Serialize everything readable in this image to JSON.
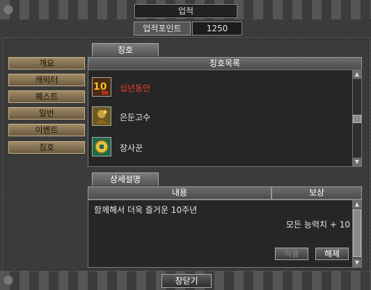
{
  "window": {
    "title": "업적"
  },
  "points": {
    "label": "업적포인트",
    "value": "1250"
  },
  "sidebar": {
    "items": [
      {
        "label": "개요"
      },
      {
        "label": "캐릭터"
      },
      {
        "label": "퀘스트"
      },
      {
        "label": "일반"
      },
      {
        "label": "이벤트"
      },
      {
        "label": "칭호"
      }
    ]
  },
  "title_tab": {
    "label": "칭호"
  },
  "title_list": {
    "header": "칭호목록",
    "items": [
      {
        "label": "십년동안",
        "icon": "tenth-anniversary-icon",
        "color": "#ff3b2f"
      },
      {
        "label": "은둔고수",
        "icon": "hermit-master-icon",
        "color": "#e8e8e8"
      },
      {
        "label": "장사꾼",
        "icon": "coin-icon",
        "color": "#e8e8e8"
      }
    ]
  },
  "detail_tab": {
    "label": "상세설명"
  },
  "detail": {
    "col_content": "내용",
    "col_reward": "보상",
    "description": "함께해서 더욱 즐거운 10주년",
    "reward": "모든 능력치 + 10",
    "apply_label": "적용",
    "release_label": "해제"
  },
  "close_button": {
    "label": "창닫기"
  }
}
